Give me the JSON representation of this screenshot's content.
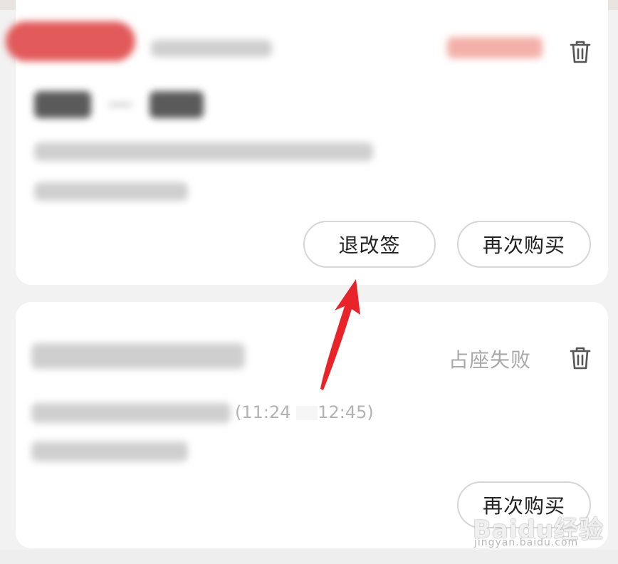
{
  "orders": [
    {
      "actions": {
        "rebook_label": "退改签",
        "buy_again_label": "再次购买"
      }
    },
    {
      "status": "占座失败",
      "time_fragment": "(11:24",
      "time_fragment_end": "12:45)",
      "actions": {
        "buy_again_label": "再次购买"
      }
    }
  ],
  "annotation": {
    "arrow_color": "#e8232a"
  },
  "watermark": {
    "logo": "Baidu经验",
    "url": "jingyan.baidu.com"
  },
  "icons": {
    "delete": "trash-icon"
  },
  "colors": {
    "accent": "#e25a5a",
    "status_failed": "#a8a8a8"
  }
}
